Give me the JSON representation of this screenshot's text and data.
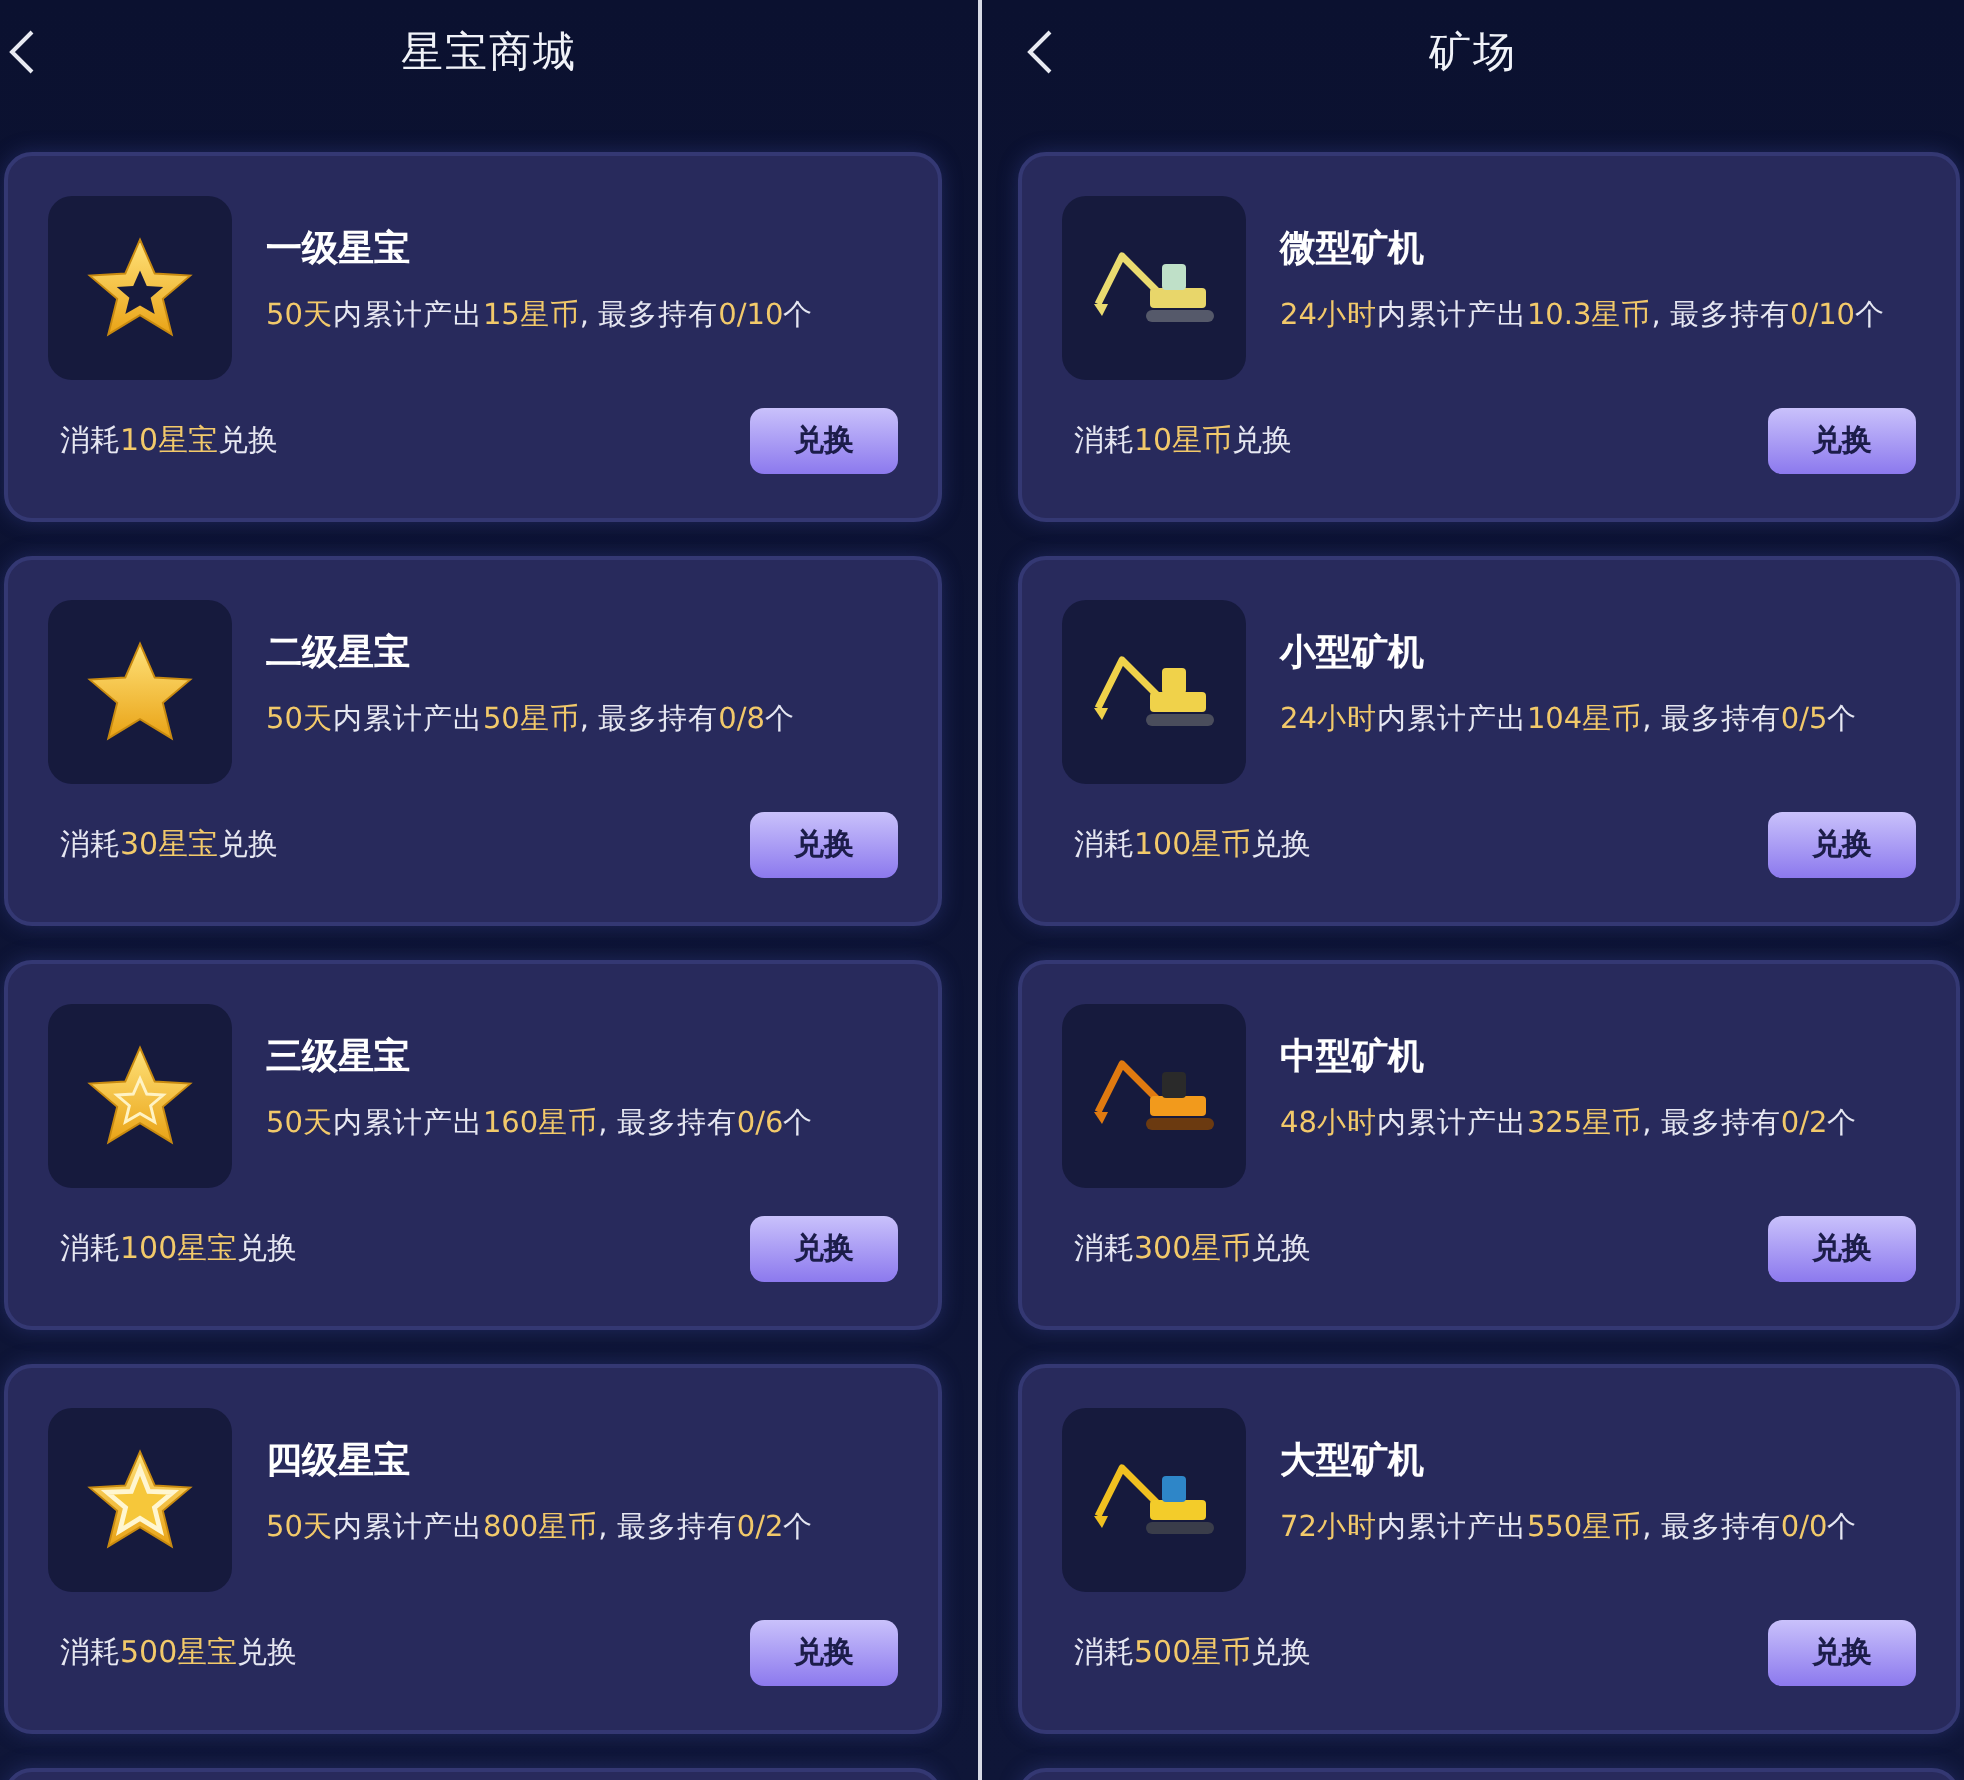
{
  "screens": [
    {
      "title": "星宝商城",
      "back_icon": true,
      "items": [
        {
          "name": "一级星宝",
          "icon": {
            "kind": "star_hollow"
          },
          "description": [
            {
              "text": "50天",
              "highlight": true
            },
            {
              "text": "内累计产出",
              "highlight": false
            },
            {
              "text": "15星币",
              "highlight": true
            },
            {
              "text": ", 最多持有",
              "highlight": false
            },
            {
              "text": "0/10",
              "highlight": true
            },
            {
              "text": "个",
              "highlight": false
            }
          ],
          "cost": [
            {
              "text": "消耗",
              "highlight": false
            },
            {
              "text": "10星宝",
              "highlight": true
            },
            {
              "text": "兑换",
              "highlight": false
            }
          ],
          "button": "兑换"
        },
        {
          "name": "二级星宝",
          "icon": {
            "kind": "star_solid"
          },
          "description": [
            {
              "text": "50天",
              "highlight": true
            },
            {
              "text": "内累计产出",
              "highlight": false
            },
            {
              "text": "50星币",
              "highlight": true
            },
            {
              "text": ", 最多持有",
              "highlight": false
            },
            {
              "text": "0/8",
              "highlight": true
            },
            {
              "text": "个",
              "highlight": false
            }
          ],
          "cost": [
            {
              "text": "消耗",
              "highlight": false
            },
            {
              "text": "30星宝",
              "highlight": true
            },
            {
              "text": "兑换",
              "highlight": false
            }
          ],
          "button": "兑换"
        },
        {
          "name": "三级星宝",
          "icon": {
            "kind": "star_inner"
          },
          "description": [
            {
              "text": "50天",
              "highlight": true
            },
            {
              "text": "内累计产出",
              "highlight": false
            },
            {
              "text": "160星币",
              "highlight": true
            },
            {
              "text": ", 最多持有",
              "highlight": false
            },
            {
              "text": "0/6",
              "highlight": true
            },
            {
              "text": "个",
              "highlight": false
            }
          ],
          "cost": [
            {
              "text": "消耗",
              "highlight": false
            },
            {
              "text": "100星宝",
              "highlight": true
            },
            {
              "text": "兑换",
              "highlight": false
            }
          ],
          "button": "兑换"
        },
        {
          "name": "四级星宝",
          "icon": {
            "kind": "star_double"
          },
          "description": [
            {
              "text": "50天",
              "highlight": true
            },
            {
              "text": "内累计产出",
              "highlight": false
            },
            {
              "text": "800星币",
              "highlight": true
            },
            {
              "text": ", 最多持有",
              "highlight": false
            },
            {
              "text": "0/2",
              "highlight": true
            },
            {
              "text": "个",
              "highlight": false
            }
          ],
          "cost": [
            {
              "text": "消耗",
              "highlight": false
            },
            {
              "text": "500星宝",
              "highlight": true
            },
            {
              "text": "兑换",
              "highlight": false
            }
          ],
          "button": "兑换"
        }
      ]
    },
    {
      "title": "矿场",
      "back_icon": true,
      "items": [
        {
          "name": "微型矿机",
          "icon": {
            "kind": "excavator_mini"
          },
          "description": [
            {
              "text": "24小时",
              "highlight": true
            },
            {
              "text": "内累计产出",
              "highlight": false
            },
            {
              "text": "10.3星币",
              "highlight": true
            },
            {
              "text": ", 最多持有",
              "highlight": false
            },
            {
              "text": "0/10",
              "highlight": true
            },
            {
              "text": "个",
              "highlight": false
            }
          ],
          "cost": [
            {
              "text": "消耗",
              "highlight": false
            },
            {
              "text": "10星币",
              "highlight": true
            },
            {
              "text": "兑换",
              "highlight": false
            }
          ],
          "button": "兑换"
        },
        {
          "name": "小型矿机",
          "icon": {
            "kind": "excavator_small"
          },
          "description": [
            {
              "text": "24小时",
              "highlight": true
            },
            {
              "text": "内累计产出",
              "highlight": false
            },
            {
              "text": "104星币",
              "highlight": true
            },
            {
              "text": ", 最多持有",
              "highlight": false
            },
            {
              "text": "0/5",
              "highlight": true
            },
            {
              "text": "个",
              "highlight": false
            }
          ],
          "cost": [
            {
              "text": "消耗",
              "highlight": false
            },
            {
              "text": "100星币",
              "highlight": true
            },
            {
              "text": "兑换",
              "highlight": false
            }
          ],
          "button": "兑换"
        },
        {
          "name": "中型矿机",
          "icon": {
            "kind": "excavator_medium"
          },
          "description": [
            {
              "text": "48小时",
              "highlight": true
            },
            {
              "text": "内累计产出",
              "highlight": false
            },
            {
              "text": "325星币",
              "highlight": true
            },
            {
              "text": ", 最多持有",
              "highlight": false
            },
            {
              "text": "0/2",
              "highlight": true
            },
            {
              "text": "个",
              "highlight": false
            }
          ],
          "cost": [
            {
              "text": "消耗",
              "highlight": false
            },
            {
              "text": "300星币",
              "highlight": true
            },
            {
              "text": "兑换",
              "highlight": false
            }
          ],
          "button": "兑换"
        },
        {
          "name": "大型矿机",
          "icon": {
            "kind": "excavator_large"
          },
          "description": [
            {
              "text": "72小时",
              "highlight": true
            },
            {
              "text": "内累计产出",
              "highlight": false
            },
            {
              "text": "550星币",
              "highlight": true
            },
            {
              "text": ", 最多持有",
              "highlight": false
            },
            {
              "text": "0/0",
              "highlight": true
            },
            {
              "text": "个",
              "highlight": false
            }
          ],
          "cost": [
            {
              "text": "消耗",
              "highlight": false
            },
            {
              "text": "500星币",
              "highlight": true
            },
            {
              "text": "兑换",
              "highlight": false
            }
          ],
          "button": "兑换"
        }
      ]
    }
  ]
}
